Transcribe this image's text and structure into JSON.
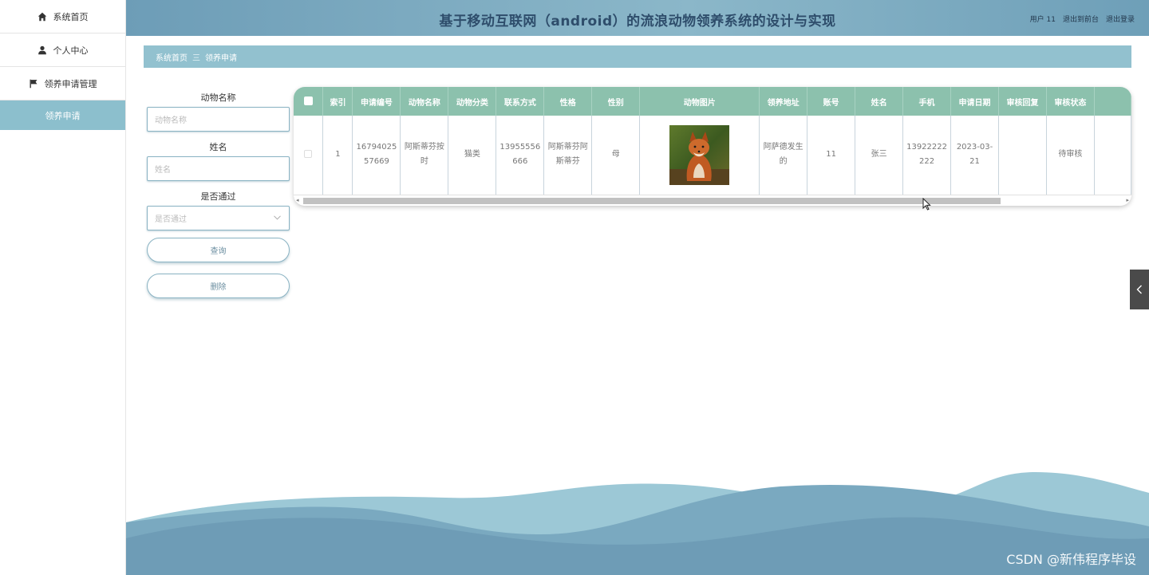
{
  "sidebar": {
    "items": [
      {
        "label": "系统首页",
        "icon": "home-icon"
      },
      {
        "label": "个人中心",
        "icon": "user-icon"
      },
      {
        "label": "领养申请管理",
        "icon": "flag-icon"
      }
    ],
    "sub_item": {
      "label": "领养申请"
    }
  },
  "header": {
    "title": "基于移动互联网（android）的流浪动物领养系统的设计与实现",
    "user_label": "用户 11",
    "back_label": "退出到前台",
    "logout_label": "退出登录"
  },
  "breadcrumb": {
    "home": "系统首页",
    "separator": "三",
    "current": "领养申请"
  },
  "search": {
    "animal_name_label": "动物名称",
    "animal_name_placeholder": "动物名称",
    "name_label": "姓名",
    "name_placeholder": "姓名",
    "passed_label": "是否通过",
    "passed_placeholder": "是否通过",
    "query_button": "查询",
    "delete_button": "删除"
  },
  "table": {
    "columns": [
      "索引",
      "申请编号",
      "动物名称",
      "动物分类",
      "联系方式",
      "性格",
      "性别",
      "动物图片",
      "领养地址",
      "账号",
      "姓名",
      "手机",
      "申请日期",
      "审核回复",
      "审核状态"
    ],
    "rows": [
      {
        "index": "1",
        "apply_no": "1679402557669",
        "animal_name": "阿斯蒂芬按时",
        "category": "猫类",
        "contact": "13955556666",
        "character": "阿斯蒂芬阿斯蒂芬",
        "gender": "母",
        "image": "fox-photo",
        "address": "阿萨德发生的",
        "account": "11",
        "name": "张三",
        "phone": "13922222222",
        "date": "2023-03-21",
        "reply": "",
        "status": "待审核"
      }
    ]
  },
  "colors": {
    "header": "#7aa9bf",
    "breadcrumb": "#92c1cf",
    "table_header": "#8cc1ad",
    "sidebar_active": "#8cbfcd"
  },
  "watermark": "CSDN @新伟程序毕设"
}
